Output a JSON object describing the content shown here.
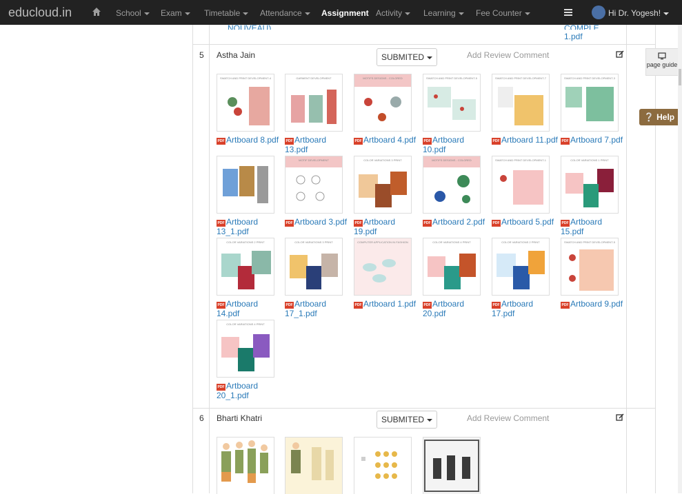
{
  "nav": {
    "brand": "educloud.in",
    "items": [
      {
        "label": "School",
        "caret": true
      },
      {
        "label": "Exam",
        "caret": true
      },
      {
        "label": "Timetable",
        "caret": true
      },
      {
        "label": "Attendance",
        "caret": true
      },
      {
        "label": "Assignment",
        "caret": false,
        "active": true
      },
      {
        "label": "Activity",
        "caret": true
      },
      {
        "label": "Learning",
        "caret": true
      },
      {
        "label": "Fee Counter",
        "caret": true
      }
    ],
    "user": "Hi Dr. Yogesh!"
  },
  "top_cut": {
    "left": "NOUVEAU)....",
    "right_line1": "COMPLE...",
    "right_line2": "1.pdf"
  },
  "rows": [
    {
      "num": "5",
      "name": "Astha Jain",
      "status": "SUBMITED",
      "review_placeholder": "Add Review Comment",
      "files": [
        {
          "name": "Artboard 8.pdf",
          "cap": "SWATCH AND PRINT DEVELOPMENT-4"
        },
        {
          "name": "Artboard 13.pdf",
          "cap": "GARMENT DEVELOPMENT"
        },
        {
          "name": "Artboard 4.pdf",
          "cap": "MOTIFS DESIGNS - COLORED"
        },
        {
          "name": "Artboard 10.pdf",
          "cap": "SWATCH AND PRINT DEVELOPMENT-5"
        },
        {
          "name": "Artboard 11.pdf",
          "cap": "SWATCH AND PRINT DEVELOPMENT-7"
        },
        {
          "name": "Artboard 7.pdf",
          "cap": "SWATCH AND PRINT DEVELOPMENT-3"
        },
        {
          "name": "Artboard 13_1.pdf",
          "cap": ""
        },
        {
          "name": "Artboard 3.pdf",
          "cap": "MOTIF DEVELOPMENT"
        },
        {
          "name": "Artboard 19.pdf",
          "cap": "COLOR VARIATIONS 3 PRINT"
        },
        {
          "name": "Artboard 2.pdf",
          "cap": "MOTIFS DESIGNS - COLORED"
        },
        {
          "name": "Artboard 5.pdf",
          "cap": "SWATCH AND PRINT DEVELOPMENT-1"
        },
        {
          "name": "Artboard 15.pdf",
          "cap": "COLOR VARIATIONS 1 PRINT"
        },
        {
          "name": "Artboard 14.pdf",
          "cap": "COLOR VARIATIONS 2 PRINT"
        },
        {
          "name": "Artboard 17_1.pdf",
          "cap": "COLOR VARIATIONS 3 PRINT"
        },
        {
          "name": "Artboard 1.pdf",
          "cap": "COMPUTER APPLICATION IN FASHION"
        },
        {
          "name": "Artboard 20.pdf",
          "cap": "COLOR VARIATIONS 4 PRINT"
        },
        {
          "name": "Artboard 17.pdf",
          "cap": "COLOR VARIATIONS 2 PRINT"
        },
        {
          "name": "Artboard 9.pdf",
          "cap": "SWATCH AND PRINT DEVELOPMENT-5"
        },
        {
          "name": "Artboard 20_1.pdf",
          "cap": "COLOR VARIATIONS 4 PRINT"
        }
      ]
    },
    {
      "num": "6",
      "name": "Bharti Khatri",
      "status": "SUBMITED",
      "review_placeholder": "Add Review Comment"
    }
  ],
  "side": {
    "page_guide": "page guide",
    "help": "Help"
  },
  "colors": {
    "navbar": "#222222",
    "link": "#2a7ab8",
    "pdf_icon": "#d9412a",
    "help": "#8c6b3f"
  }
}
